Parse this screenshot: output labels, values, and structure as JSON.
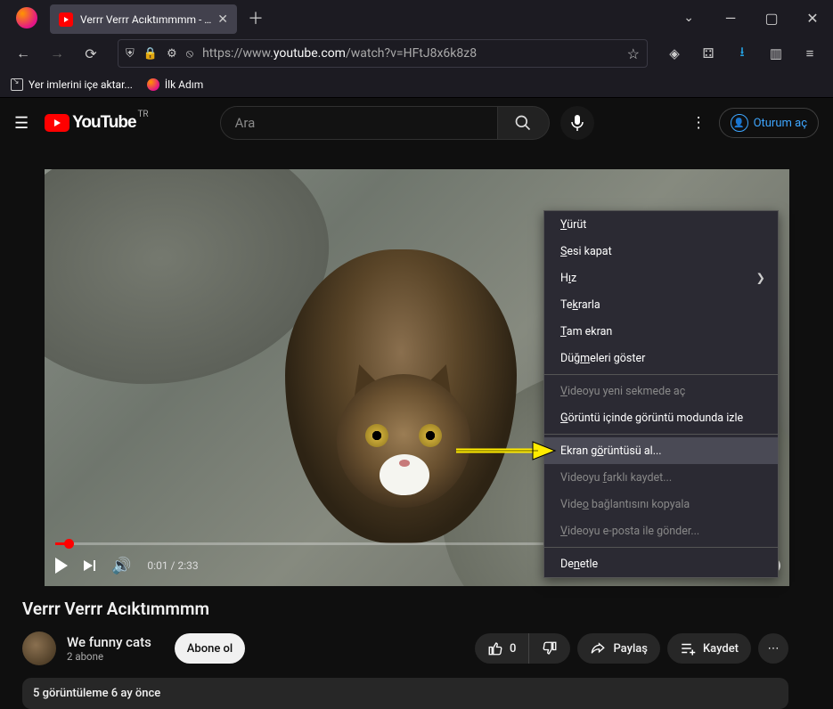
{
  "browser": {
    "tab_title": "Verrr Verrr Acıktımmmm - YouT",
    "url_prefix": "https://www.",
    "url_domain": "youtube.com",
    "url_path": "/watch?v=HFtJ8x6k8z8",
    "bookmarks": [
      {
        "label": "Yer imlerini içe aktar..."
      },
      {
        "label": "İlk Adım"
      }
    ]
  },
  "youtube": {
    "search_placeholder": "Ara",
    "region": "TR",
    "brand": "YouTube",
    "signin": "Oturum aç"
  },
  "video": {
    "time_current": "0:01",
    "time_total": "2:33",
    "title": "Verrr Verrr Acıktımmmm",
    "channel": "We funny cats",
    "subs": "2 abone",
    "subscribe": "Abone ol",
    "likes": "0",
    "share": "Paylaş",
    "save": "Kaydet",
    "views_line": "5 görüntüleme  6 ay önce"
  },
  "ctx": {
    "items": [
      {
        "pre": "",
        "k": "Y",
        "post": "ürüt"
      },
      {
        "pre": "",
        "k": "S",
        "post": "esi kapat"
      },
      {
        "pre": "H",
        "k": "ı",
        "post": "z",
        "arrow": true
      },
      {
        "pre": "Te",
        "k": "k",
        "post": "rarla"
      },
      {
        "pre": "",
        "k": "T",
        "post": "am ekran"
      },
      {
        "pre": "Düğ",
        "k": "m",
        "post": "eleri göster"
      }
    ],
    "group2": [
      {
        "pre": "",
        "k": "V",
        "post": "ideoyu yeni sekmede aç",
        "disabled": true
      },
      {
        "pre": "",
        "k": "G",
        "post": "örüntü içinde görüntü modunda izle"
      }
    ],
    "group3": [
      {
        "pre": "Ekran g",
        "k": "ö",
        "post": "rüntüsü al...",
        "highlight": true
      },
      {
        "pre": "Videoyu ",
        "k": "f",
        "post": "arklı kaydet...",
        "disabled": true
      },
      {
        "pre": "Vide",
        "k": "o",
        "post": " bağlantısını kopyala",
        "disabled": true
      },
      {
        "pre": "",
        "k": "V",
        "post": "ideoyu e-posta ile gönder...",
        "disabled": true
      }
    ],
    "group4": [
      {
        "pre": "De",
        "k": "n",
        "post": "etle"
      }
    ]
  }
}
